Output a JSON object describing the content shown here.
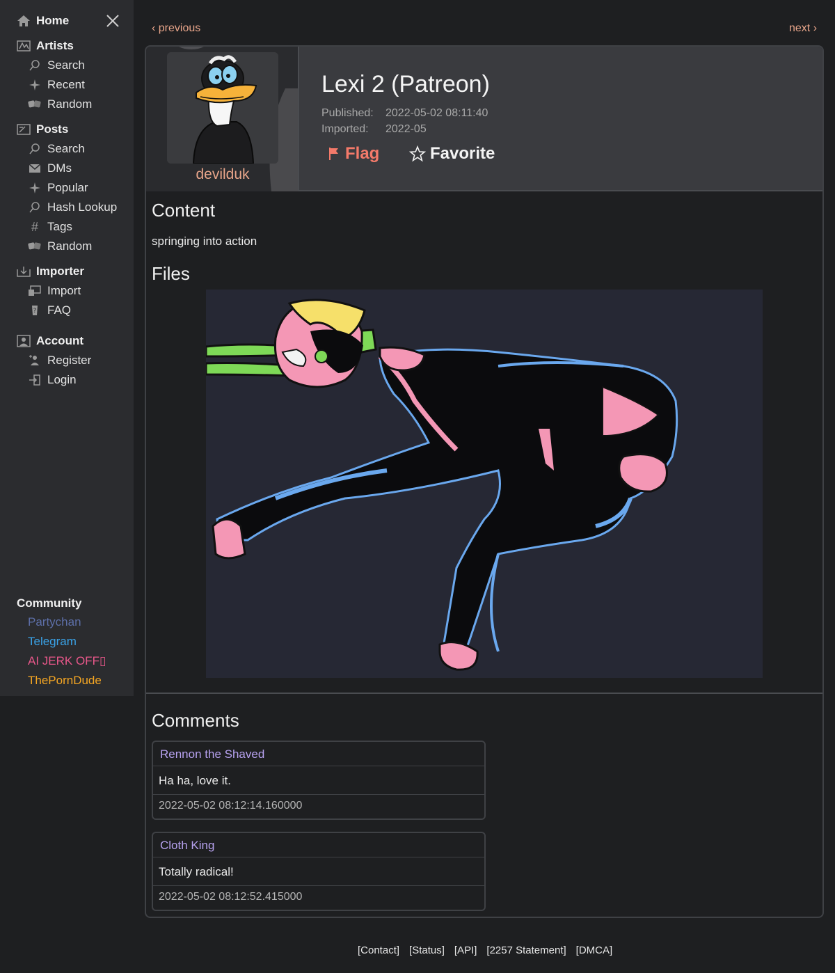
{
  "sidebar": {
    "home": "Home",
    "artists": {
      "title": "Artists",
      "items": [
        "Search",
        "Recent",
        "Random"
      ]
    },
    "posts": {
      "title": "Posts",
      "items": [
        "Search",
        "DMs",
        "Popular",
        "Hash Lookup",
        "Tags",
        "Random"
      ]
    },
    "importer": {
      "title": "Importer",
      "items": [
        "Import",
        "FAQ"
      ]
    },
    "account": {
      "title": "Account",
      "items": [
        "Register",
        "Login"
      ]
    },
    "community": {
      "title": "Community",
      "links": [
        {
          "label": "Partychan",
          "color": "#5d6fa8"
        },
        {
          "label": "Telegram",
          "color": "#3aa3e8"
        },
        {
          "label": "AI JERK OFF▯",
          "color": "#e8578a"
        },
        {
          "label": "ThePornDude",
          "color": "#f5a623"
        }
      ]
    }
  },
  "pager": {
    "previous": "‹ previous",
    "next": "next ›"
  },
  "post": {
    "artist": "devilduk",
    "title": "Lexi 2 (Patreon)",
    "published_label": "Published:",
    "published": "2022-05-02 08:11:40",
    "imported_label": "Imported:",
    "imported": "2022-05",
    "flag": "Flag",
    "favorite": "Favorite",
    "content_heading": "Content",
    "content": "springing into action",
    "files_heading": "Files"
  },
  "comments": {
    "heading": "Comments",
    "items": [
      {
        "author": "Rennon the Shaved",
        "text": "Ha ha, love it.",
        "date": "2022-05-02 08:12:14.160000"
      },
      {
        "author": "Cloth King",
        "text": "Totally radical!",
        "date": "2022-05-02 08:12:52.415000"
      }
    ]
  },
  "footer": [
    "[Contact]",
    "[Status]",
    "[API]",
    "[2257 Statement]",
    "[DMCA]"
  ]
}
